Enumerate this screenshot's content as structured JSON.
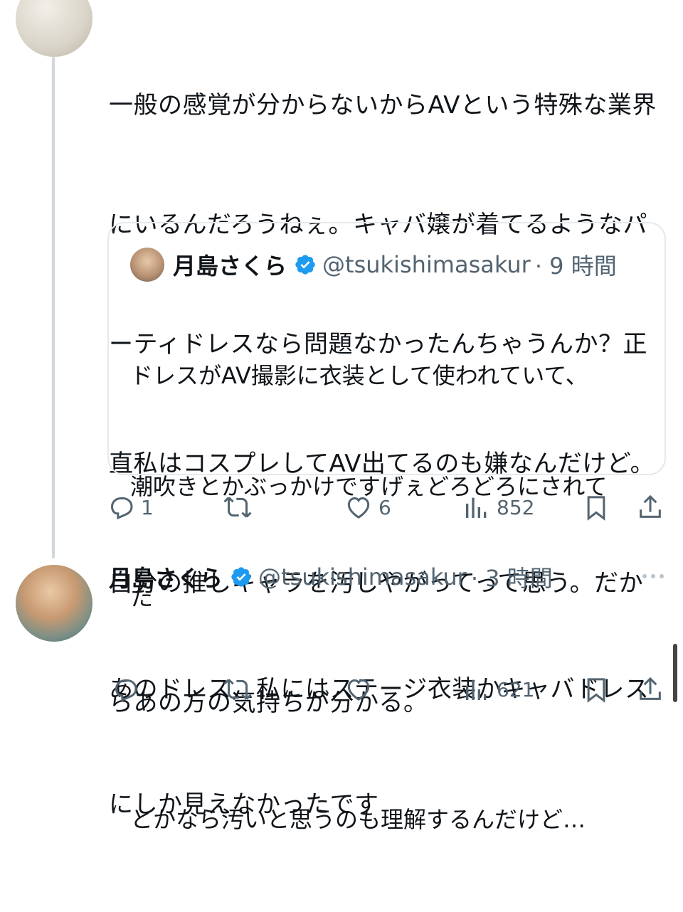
{
  "colors": {
    "text": "#0f1419",
    "muted": "#536471",
    "verified": "#1d9bf0",
    "thread_line": "#cfd9de",
    "border": "#e5e9ec"
  },
  "tweet1": {
    "lines": [
      "一般の感覚が分からないからAVという特殊な業界",
      "にいるんだろうねぇ。キャバ嬢が着てるようなパ",
      "ーティドレスなら問題なかったんちゃうんか？正",
      "直私はコスプレしてAV出てるのも嫌なんだけど。",
      "自分の推しキャラを汚しやがってって思う。だか",
      "らあの方の気持ちが分かる。"
    ],
    "quote": {
      "name": "月島さくら",
      "handle": "@tsukishimasakur",
      "time": "· 9 時間",
      "body_lines": [
        "ドレスがAV撮影に衣装として使われていて、",
        "潮吹きとかぶっかけですげぇどろどろにされて",
        "た",
        "",
        "とかなら汚いと思うのも理解するんだけど…"
      ]
    },
    "actions": {
      "reply_count": "1",
      "like_count": "6",
      "views_count": "852"
    }
  },
  "tweet2": {
    "name": "月島さくら",
    "handle": "@tsukishimasakur",
    "time": "· 3 時間",
    "lines": [
      "あのドレス、私にはステージ衣装かキャバドレス",
      "にしか見えなかったです"
    ],
    "actions": {
      "views_count": "621"
    }
  },
  "icons": [
    "reply-icon",
    "retweet-icon",
    "like-icon",
    "views-icon",
    "bookmark-icon",
    "share-icon",
    "verified-icon",
    "more-icon"
  ]
}
